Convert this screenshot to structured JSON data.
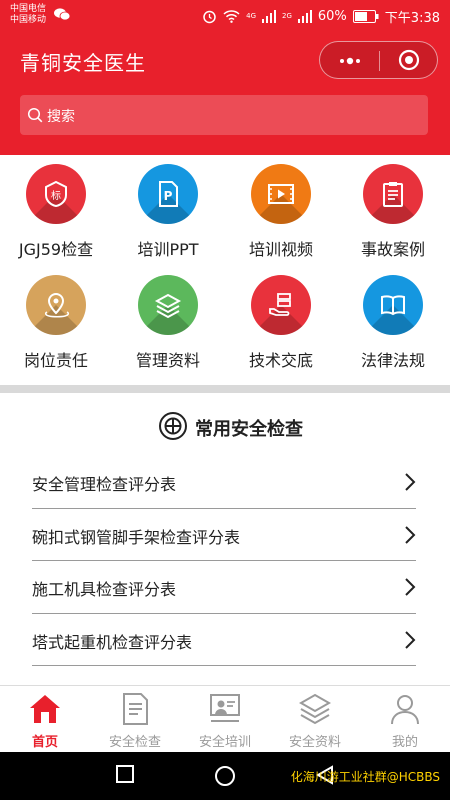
{
  "status_bar": {
    "carrier_1": "中国电信",
    "carrier_2": "中国移动",
    "network_1": "4G",
    "network_2": "2G",
    "battery": "60%",
    "time": "下午3:38"
  },
  "header": {
    "title": "青铜安全医生"
  },
  "search": {
    "placeholder": "搜索"
  },
  "grid": [
    {
      "label": "JGJ59检查",
      "icon": "badge-icon",
      "color": "#e8323c"
    },
    {
      "label": "培训PPT",
      "icon": "ppt-icon",
      "color": "#1597e0"
    },
    {
      "label": "培训视频",
      "icon": "video-icon",
      "color": "#f07a14"
    },
    {
      "label": "事故案例",
      "icon": "clipboard-icon",
      "color": "#e8323c"
    },
    {
      "label": "岗位责任",
      "icon": "location-icon",
      "color": "#d6a35c"
    },
    {
      "label": "管理资料",
      "icon": "layers-icon",
      "color": "#5cb85c"
    },
    {
      "label": "技术交底",
      "icon": "hand-stack-icon",
      "color": "#e8323c"
    },
    {
      "label": "法律法规",
      "icon": "book-icon",
      "color": "#1597e0"
    }
  ],
  "section": {
    "title": "常用安全检查",
    "items": [
      "安全管理检查评分表",
      "碗扣式钢管脚手架检查评分表",
      "施工机具检查评分表",
      "塔式起重机检查评分表"
    ]
  },
  "tabs": [
    {
      "label": "首页",
      "icon": "home-icon",
      "active": true
    },
    {
      "label": "安全检查",
      "icon": "document-icon",
      "active": false
    },
    {
      "label": "安全培训",
      "icon": "training-icon",
      "active": false
    },
    {
      "label": "安全资料",
      "icon": "layers-icon",
      "active": false
    },
    {
      "label": "我的",
      "icon": "user-icon",
      "active": false
    }
  ],
  "watermark": "化海川游工业社群@HCBBS",
  "colors": {
    "brand_red": "#e8202c",
    "tab_inactive": "#9a9a9a"
  }
}
